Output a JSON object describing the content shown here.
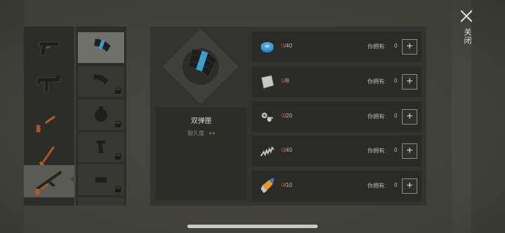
{
  "close": {
    "label": "关闭"
  },
  "weapons": [
    {
      "icon": "pistol-icon",
      "active": false
    },
    {
      "icon": "smg-icon",
      "active": false
    },
    {
      "icon": "shotgun-icon",
      "active": false
    },
    {
      "icon": "rifle-icon",
      "active": false
    },
    {
      "icon": "ak-rifle-icon",
      "active": true
    },
    {
      "icon": "sniper-rifle-icon",
      "active": false
    }
  ],
  "parts": [
    {
      "icon": "double-magazine-icon",
      "locked": false,
      "active": true
    },
    {
      "icon": "curved-magazine-icon",
      "locked": true
    },
    {
      "icon": "drum-magazine-icon",
      "locked": true
    },
    {
      "icon": "grip-icon",
      "locked": true
    },
    {
      "icon": "muzzle-icon",
      "locked": true
    },
    {
      "icon": "scope-icon",
      "locked": true
    }
  ],
  "item": {
    "name": "双弹匣",
    "durability_label": "耐久度",
    "durability_value": "++"
  },
  "materials": [
    {
      "icon": "tape-icon",
      "have": "0",
      "need": "/40",
      "owned_label": "你拥有:",
      "owned_value": "0"
    },
    {
      "icon": "metal-sheet-icon",
      "have": "0",
      "need": "/8",
      "owned_label": "你拥有:",
      "owned_value": "0"
    },
    {
      "icon": "nuts-bolts-icon",
      "have": "0",
      "need": "/20",
      "owned_label": "你拥有:",
      "owned_value": "0"
    },
    {
      "icon": "spring-icon",
      "have": "0",
      "need": "/40",
      "owned_label": "你拥有:",
      "owned_value": "0"
    },
    {
      "icon": "glue-icon",
      "have": "0",
      "need": "/10",
      "owned_label": "你拥有:",
      "owned_value": "0"
    }
  ],
  "colors": {
    "accent_red": "#d9473a",
    "accent_green": "#6fbf4a",
    "magazine_band": "#3aa0c8"
  }
}
